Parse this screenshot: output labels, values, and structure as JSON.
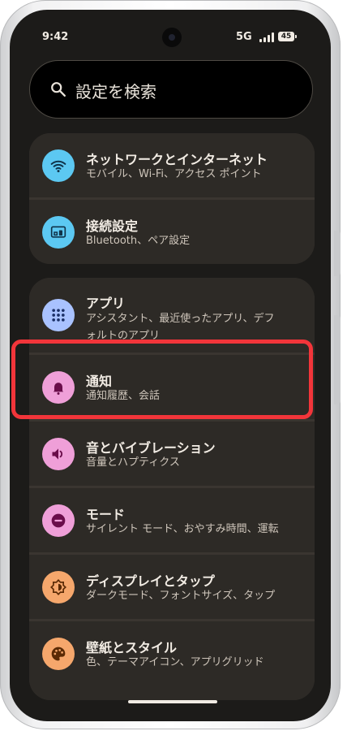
{
  "status_bar": {
    "time": "9:42",
    "network": "5G",
    "battery": "45"
  },
  "search": {
    "placeholder": "設定を検索"
  },
  "settings": [
    {
      "title": "ネットワークとインターネット",
      "subtitle": "モバイル、Wi-Fi、アクセス ポイント",
      "icon": "wifi-icon",
      "icon_bg": "#5cc8f2"
    },
    {
      "title": "接続設定",
      "subtitle": "Bluetooth、ペア設定",
      "icon": "devices-icon",
      "icon_bg": "#5cc8f2"
    },
    {
      "title": "アプリ",
      "subtitle_line1": "アシスタント、最近使ったアプリ、デフ",
      "subtitle_line2": "ォルトのアプリ",
      "icon": "apps-grid-icon",
      "icon_bg": "#a9c2ff"
    },
    {
      "title": "通知",
      "subtitle": "通知履歴、会話",
      "icon": "bell-icon",
      "icon_bg": "#ef9fd8"
    },
    {
      "title": "音とバイブレーション",
      "subtitle": "音量とハプティクス",
      "icon": "volume-icon",
      "icon_bg": "#ef9fd8"
    },
    {
      "title": "モード",
      "subtitle": "サイレント モード、おやすみ時間、運転",
      "icon": "do-not-disturb-icon",
      "icon_bg": "#ef9fd8"
    },
    {
      "title": "ディスプレイとタップ",
      "subtitle": "ダークモード、フォントサイズ、タップ",
      "icon": "brightness-icon",
      "icon_bg": "#f5a76c"
    },
    {
      "title": "壁紙とスタイル",
      "subtitle": "色、テーマアイコン、アプリグリッド",
      "icon": "palette-icon",
      "icon_bg": "#f5a76c"
    }
  ],
  "colors": {
    "background": "#1c1b19",
    "card": "#2d2a26",
    "highlight": "#f2353a"
  }
}
